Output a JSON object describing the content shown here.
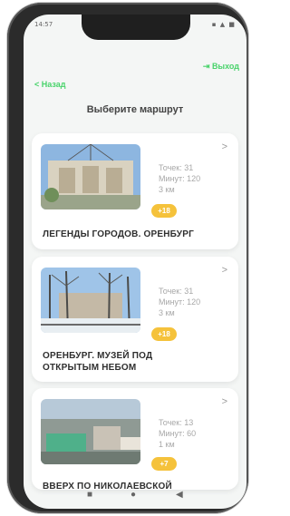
{
  "status": {
    "time": "14:57",
    "icons": "▪ ▲ ■"
  },
  "header": {
    "logout": "Выход",
    "back": "< Назад",
    "title": "Выберите маршрут"
  },
  "routes": [
    {
      "name": "ЛЕГЕНДЫ ГОРОДОВ. ОРЕНБУРГ",
      "points": "Точек: 31",
      "minutes": "Минут: 120",
      "distance": "3 км",
      "age": "+18"
    },
    {
      "name": "ОРЕНБУРГ. МУЗЕЙ ПОД ОТКРЫТЫМ НЕБОМ",
      "points": "Точек: 31",
      "minutes": "Минут: 120",
      "distance": "3 км",
      "age": "+18"
    },
    {
      "name": "ВВЕРХ ПО НИКОЛАЕВСКОЙ",
      "points": "Точек: 13",
      "minutes": "Минут: 60",
      "distance": "1 км",
      "age": "+7"
    }
  ],
  "nav": {
    "home": "■",
    "circle": "●",
    "back": "◀"
  },
  "colors": {
    "accent": "#49d36b",
    "badge": "#f5c23b"
  }
}
